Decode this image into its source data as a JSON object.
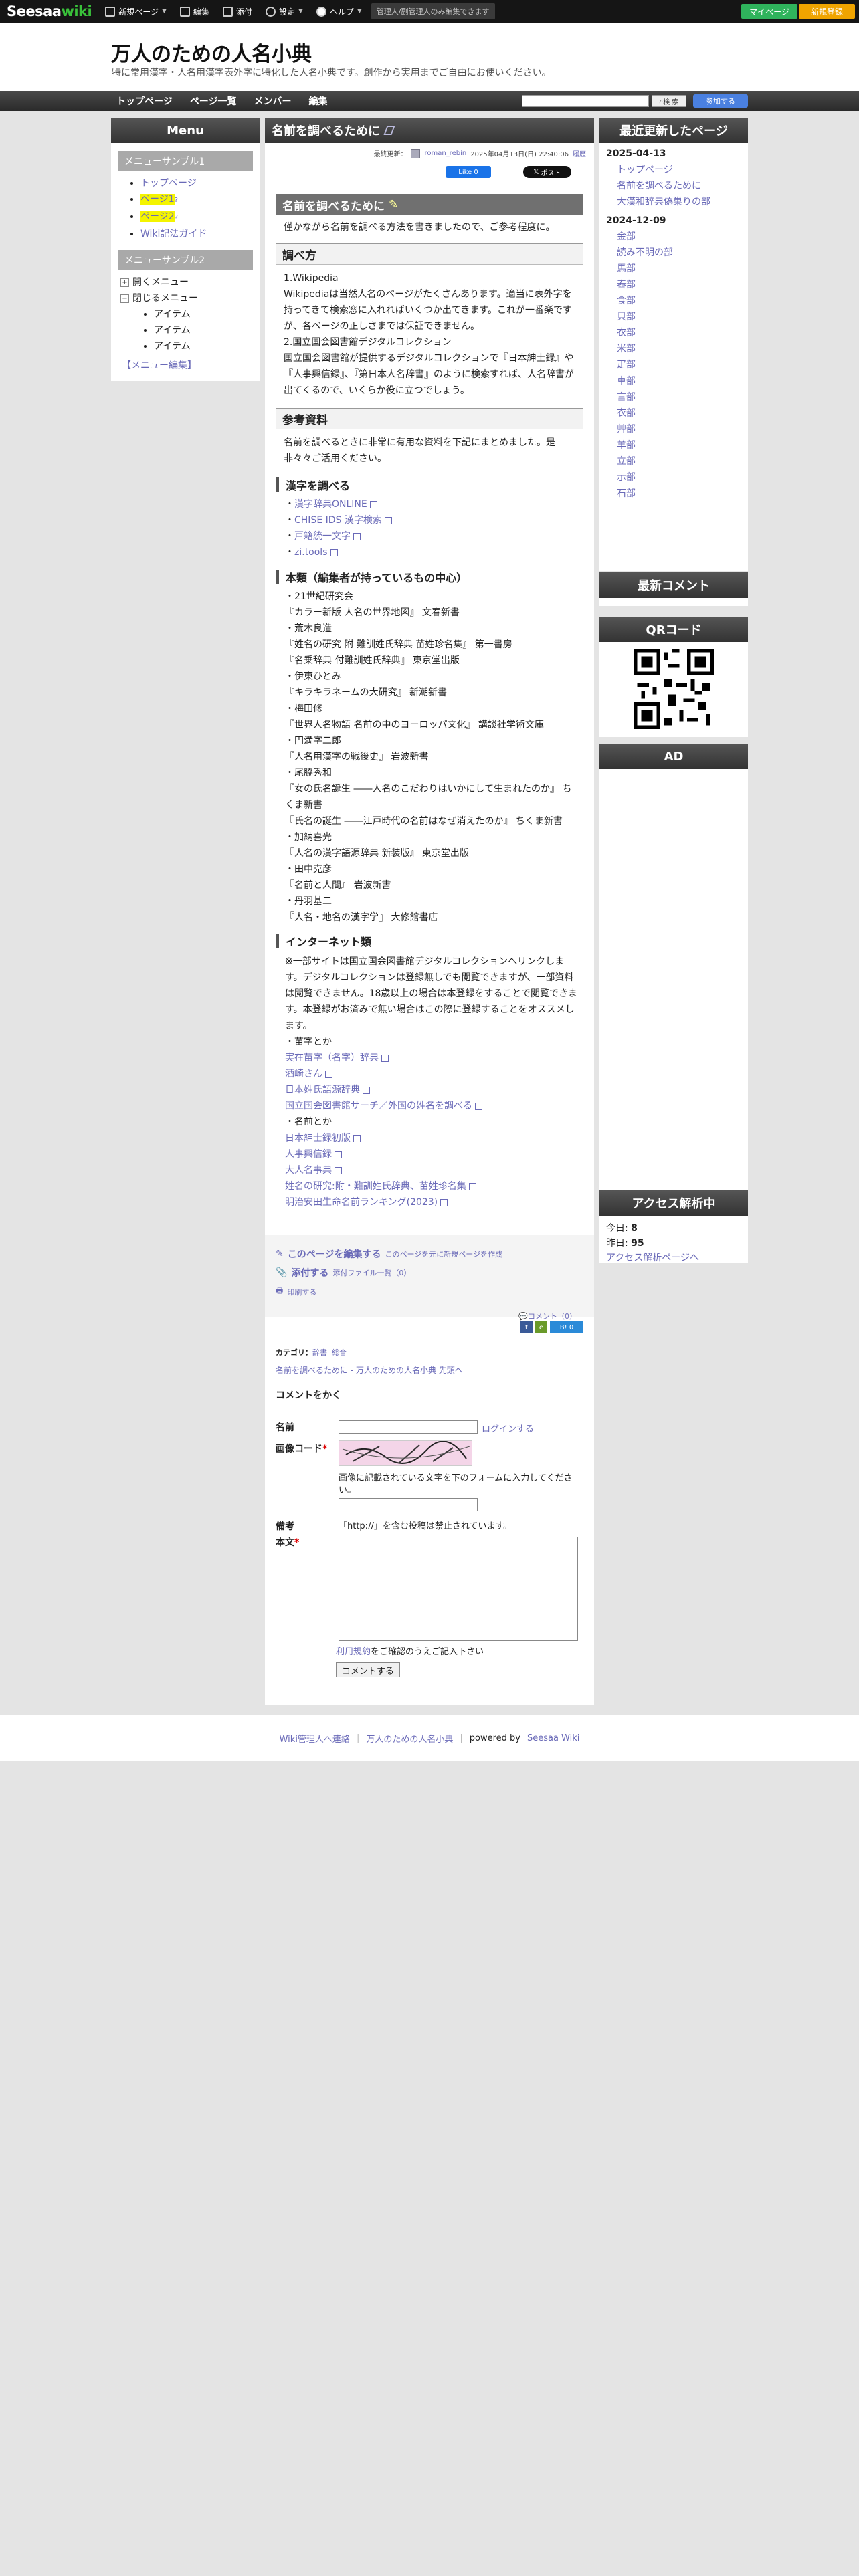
{
  "topbar": {
    "logo_main": "Seesaa",
    "logo_accent": "wiki",
    "items": [
      "新規ページ",
      "編集",
      "添付",
      "設定",
      "ヘルプ"
    ],
    "note": "管理人/副管理人のみ編集できます",
    "mypage": "マイページ",
    "register": "新規登録"
  },
  "header": {
    "title": "万人のための人名小典",
    "description": "特に常用漢字・人名用漢字表外字に特化した人名小典です。創作から実用までご自由にお使いください。"
  },
  "nav": [
    "トップページ",
    "ページ一覧",
    "メンバー",
    "編集"
  ],
  "search": {
    "button": "検 索",
    "join": "参加する"
  },
  "left": {
    "title": "Menu",
    "sub1": "メニューサンプル1",
    "sub1_items": [
      "トップページ",
      "ページ1",
      "ページ2",
      "Wiki記法ガイド"
    ],
    "sub2": "メニューサンプル2",
    "open_menu": "開くメニュー",
    "closed_menu": "閉じるメニュー",
    "closed_items": [
      "アイテム",
      "アイテム",
      "アイテム"
    ],
    "edit_menu": "【メニュー編集】"
  },
  "article": {
    "title": "名前を調べるために",
    "updated_label": "最終更新：",
    "author": "roman_rebin",
    "updated": "2025年04月13日(日) 22:40:06",
    "history": "履歴",
    "fb": "Like 0",
    "xpost": "ポスト",
    "h1": "名前を調べるために",
    "p1": "僅かながら名前を調べる方法を書きましたので、ご参考程度に。",
    "h_howto": "調べ方",
    "howto": [
      "1.Wikipedia",
      "Wikipediaは当然人名のページがたくさんあります。適当に表外字を持ってきて検索窓に入れればいくつか出てきます。これが一番楽ですが、各ページの正しさまでは保証できません。",
      "2.国立国会図書館デジタルコレクション",
      "国立国会図書館が提供するデジタルコレクションで『日本紳士録』や『人事興信録』、『第日本人名辞書』のように検索すれば、人名辞書が出てくるので、いくらか役に立つでしょう。"
    ],
    "h_ref": "参考資料",
    "ref_intro": "名前を調べるときに非常に有用な資料を下記にまとめました。是非々々ご活用ください。",
    "h_kanji": "漢字を調べる",
    "kanji_links": [
      "漢字辞典ONLINE",
      "CHISE IDS 漢字検索",
      "戸籍統一文字",
      "zi.tools"
    ],
    "h_books": "本類（編集者が持っているもの中心）",
    "books": [
      "・21世紀研究会",
      "『カラー新版 人名の世界地図』 文春新書",
      "・荒木良造",
      "『姓名の研究 附 難訓姓氏辞典 苗姓珍名集』 第一書房",
      "『名乗辞典 付難訓姓氏辞典』 東京堂出版",
      "・伊東ひとみ",
      "『キラキラネームの大研究』 新潮新書",
      "・梅田修",
      "『世界人名物語 名前の中のヨーロッパ文化』 講談社学術文庫",
      "・円満字二郎",
      "『人名用漢字の戦後史』 岩波新書",
      "・尾脇秀和",
      "『女の氏名誕生 ――人名のこだわりはいかにして生まれたのか』 ちくま新書",
      "『氏名の誕生 ――江戸時代の名前はなぜ消えたのか』 ちくま新書",
      "・加納喜光",
      "『人名の漢字語源辞典 新装版』 東京堂出版",
      "・田中克彦",
      "『名前と人間』 岩波新書",
      "・丹羽基二",
      "『人名・地名の漢字学』 大修館書店"
    ],
    "h_net": "インターネット類",
    "net_note": "※一部サイトは国立国会図書館デジタルコレクションへリンクします。デジタルコレクションは登録無しでも閲覧できますが、一部資料は閲覧できません。18歳以上の場合は本登録をすることで閲覧できます。本登録がお済みで無い場合はこの際に登録することをオススメします。",
    "net_g1": "・苗字とか",
    "net_links1": [
      "実在苗字（名字）辞典",
      "酒崎さん",
      "日本姓氏語源辞典",
      "国立国会図書館サーチ／外国の姓名を調べる"
    ],
    "net_g2": "・名前とか",
    "net_links2": [
      "日本紳士録初版",
      "人事興信録",
      "大人名事典",
      "姓名の研究:附・難訓姓氏辞典、苗姓珍名集",
      "明治安田生命名前ランキング(2023)"
    ],
    "edit_page": "このページを編集する",
    "edit_page_sub": "このページを元に新規ページを作成",
    "attach": "添付する",
    "attach_sub": "添付ファイル一覧（0）",
    "print": "印刷する",
    "comment_count": "コメント（0）",
    "bookmark_count": "B! 0",
    "category_label": "カテゴリ：",
    "categories": [
      "辞書",
      "総合"
    ],
    "breadcrumb": "名前を調べるために - 万人のための人名小典 先頭へ",
    "comment_title": "コメントをかく",
    "name_label": "名前",
    "login": "ログインする",
    "captcha_label": "画像コード",
    "captcha_help": "画像に記載されている文字を下のフォームに入力してください。",
    "note_label": "備考",
    "note_text": "「http://」を含む投稿は禁止されています。",
    "body_label": "本文",
    "terms_link": "利用規約",
    "terms_text": "をご確認のうえご記入下さい",
    "submit": "コメントする"
  },
  "right": {
    "recent_title": "最近更新したページ",
    "date1": "2025-04-13",
    "date1_items": [
      "トップページ",
      "名前を調べるために",
      "大漢和辞典偽巣りの部"
    ],
    "date2": "2024-12-09",
    "date2_items": [
      "金部",
      "読み不明の部",
      "馬部",
      "舂部",
      "食部",
      "貝部",
      "衣部",
      "米部",
      "疋部",
      "車部",
      "言部",
      "衣部",
      "艸部",
      "羊部",
      "立部",
      "示部",
      "石部"
    ],
    "comment_title": "最新コメント",
    "qr_title": "QRコード",
    "ad_title": "AD",
    "access_title": "アクセス解析中",
    "today_label": "今日:",
    "today": "8",
    "yesterday_label": "昨日:",
    "yesterday": "95",
    "access_link": "アクセス解析ページへ"
  },
  "footer": {
    "contact": "Wiki管理人へ連絡",
    "site": "万人のための人名小典",
    "powered": "powered by",
    "brand": "Seesaa Wiki"
  }
}
